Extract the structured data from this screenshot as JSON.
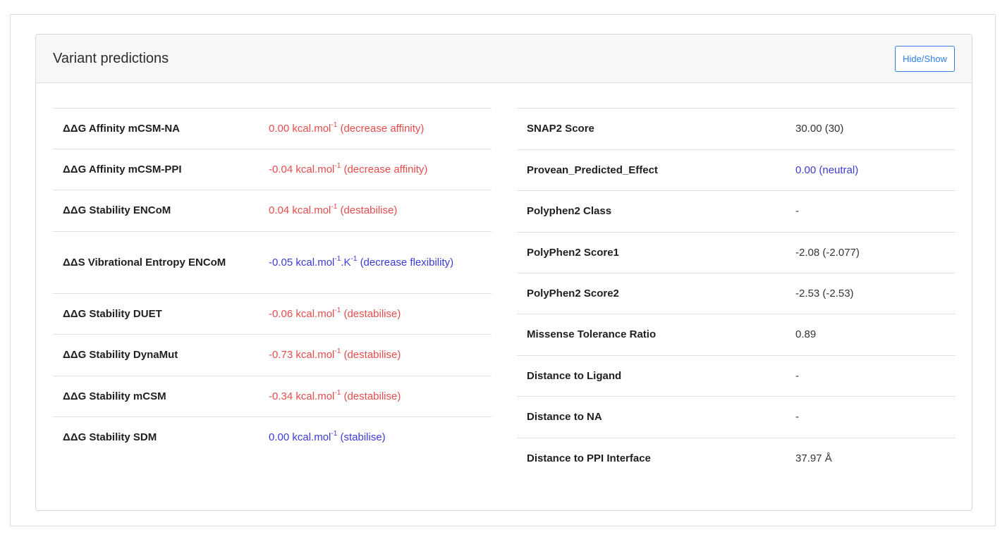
{
  "panel": {
    "title": "Variant predictions",
    "toggle_label": "Hide/Show"
  },
  "left_rows": [
    {
      "label": "ΔΔG Affinity mCSM-NA",
      "value": "0.00",
      "unit": "kcal.mol",
      "exp": "-1",
      "unit2": "",
      "exp2": "",
      "note": "(decrease affinity)",
      "color": "red"
    },
    {
      "label": "ΔΔG Affinity mCSM-PPI",
      "value": "-0.04",
      "unit": "kcal.mol",
      "exp": "-1",
      "unit2": "",
      "exp2": "",
      "note": "(decrease affinity)",
      "color": "red"
    },
    {
      "label": "ΔΔG Stability ENCoM",
      "value": "0.04",
      "unit": "kcal.mol",
      "exp": "-1",
      "unit2": "",
      "exp2": "",
      "note": "(destabilise)",
      "color": "red"
    },
    {
      "label": "ΔΔS Vibrational Entropy ENCoM",
      "value": "-0.05",
      "unit": "kcal.mol",
      "exp": "-1",
      "unit2": ".K",
      "exp2": "-1",
      "note": "(decrease flexibility)",
      "color": "blue"
    },
    {
      "label": "ΔΔG Stability DUET",
      "value": "-0.06",
      "unit": "kcal.mol",
      "exp": "-1",
      "unit2": "",
      "exp2": "",
      "note": "(destabilise)",
      "color": "red"
    },
    {
      "label": "ΔΔG Stability DynaMut",
      "value": "-0.73",
      "unit": "kcal.mol",
      "exp": "-1",
      "unit2": "",
      "exp2": "",
      "note": "(destabilise)",
      "color": "red"
    },
    {
      "label": "ΔΔG Stability mCSM",
      "value": "-0.34",
      "unit": "kcal.mol",
      "exp": "-1",
      "unit2": "",
      "exp2": "",
      "note": "(destabilise)",
      "color": "red"
    },
    {
      "label": "ΔΔG Stability SDM",
      "value": "0.00",
      "unit": "kcal.mol",
      "exp": "-1",
      "unit2": "",
      "exp2": "",
      "note": "(stabilise)",
      "color": "blue"
    }
  ],
  "right_rows": [
    {
      "label": "SNAP2 Score",
      "value": "30.00 (30)",
      "color": "plain"
    },
    {
      "label": "Provean_Predicted_Effect",
      "value": "0.00 (neutral)",
      "color": "blue"
    },
    {
      "label": "Polyphen2 Class",
      "value": "-",
      "color": "plain"
    },
    {
      "label": "PolyPhen2 Score1",
      "value": "-2.08 (-2.077)",
      "color": "plain"
    },
    {
      "label": "PolyPhen2 Score2",
      "value": "-2.53 (-2.53)",
      "color": "plain"
    },
    {
      "label": "Missense Tolerance Ratio",
      "value": "0.89",
      "color": "plain"
    },
    {
      "label": "Distance to Ligand",
      "value": "-",
      "color": "plain"
    },
    {
      "label": "Distance to NA",
      "value": "-",
      "color": "plain"
    },
    {
      "label": "Distance to PPI Interface",
      "value": "37.97 Å",
      "color": "plain"
    }
  ],
  "colors": {
    "destabilising": "#e74c4c",
    "stabilising": "#3b3bd6",
    "accent": "#2f80ed"
  }
}
